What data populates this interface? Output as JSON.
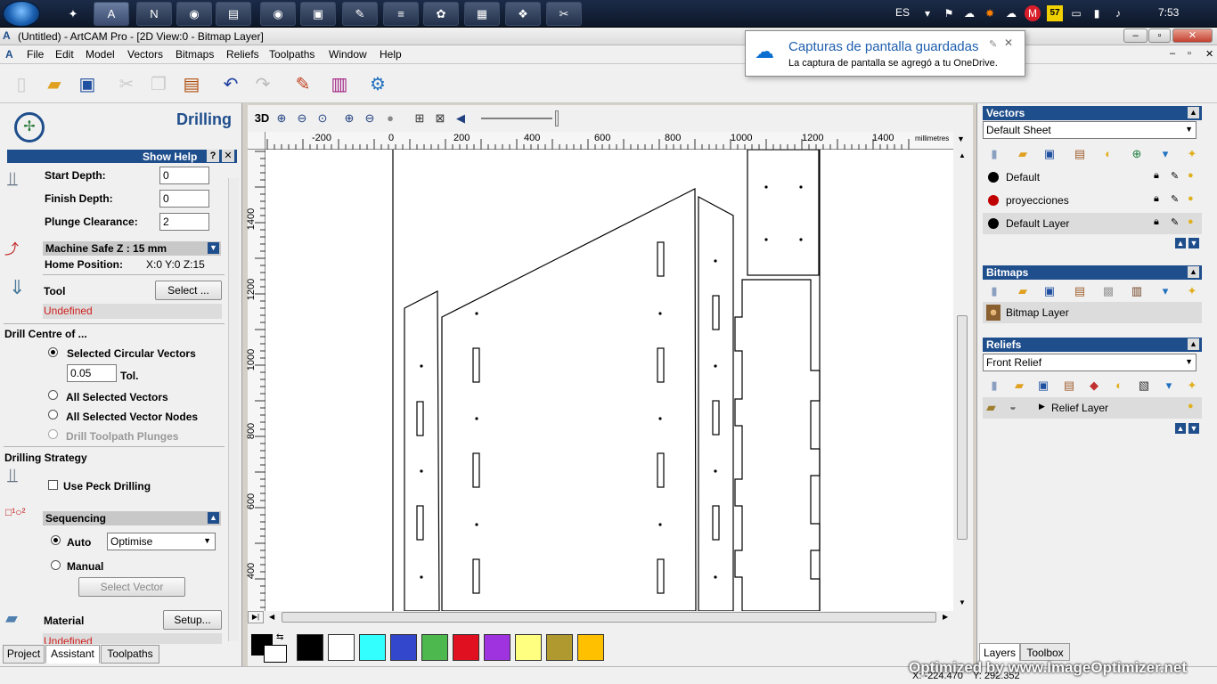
{
  "taskbar": {
    "lang": "ES",
    "clock": "7:53",
    "badge": "57"
  },
  "window": {
    "title": "(Untitled) - ArtCAM Pro - [2D View:0 - Bitmap Layer]"
  },
  "menu": [
    "File",
    "Edit",
    "Model",
    "Vectors",
    "Bitmaps",
    "Reliefs",
    "Toolpaths",
    "Window",
    "Help"
  ],
  "toast": {
    "title": "Capturas de pantalla guardadas",
    "body": "La captura de pantalla se agregó a tu OneDrive."
  },
  "left": {
    "title": "Drilling",
    "show_help": "Show Help",
    "start_depth_label": "Start Depth:",
    "start_depth": "0",
    "finish_depth_label": "Finish Depth:",
    "finish_depth": "0",
    "plunge_label": "Plunge Clearance:",
    "plunge": "2",
    "safe_z": "Machine Safe Z : 15 mm",
    "home_label": "Home Position:",
    "home_value": "X:0 Y:0 Z:15",
    "tool_label": "Tool",
    "select_btn": "Select ...",
    "tool_status": "Undefined",
    "drill_centre": "Drill Centre of ...",
    "opt_circular": "Selected Circular Vectors",
    "tol_value": "0.05",
    "tol_label": "Tol.",
    "opt_all_vectors": "All Selected Vectors",
    "opt_all_nodes": "All Selected Vector Nodes",
    "opt_plunges": "Drill Toolpath Plunges",
    "strategy": "Drilling Strategy",
    "peck": "Use Peck Drilling",
    "sequencing": "Sequencing",
    "auto": "Auto",
    "optimise": "Optimise",
    "manual": "Manual",
    "select_vector": "Select Vector",
    "material": "Material",
    "setup": "Setup...",
    "material_status": "Undefined",
    "tabs": [
      "Project",
      "Assistant",
      "Toolpaths"
    ]
  },
  "ruler": {
    "h_ticks": [
      "-200",
      "0",
      "200",
      "400",
      "600",
      "800",
      "1000",
      "1200",
      "1400"
    ],
    "unit": "millimetres",
    "v_ticks": [
      "1400",
      "1200",
      "1000",
      "800",
      "600",
      "400"
    ]
  },
  "colors": {
    "accent": "#1f4e8c",
    "swatches": [
      "#000000",
      "#ffffff",
      "#33ffff",
      "#3347cc",
      "#4db84d",
      "#e01020",
      "#a033e0",
      "#ffff80",
      "#b09a30",
      "#ffc000"
    ]
  },
  "vectors": {
    "header": "Vectors",
    "sheet": "Default Sheet",
    "layers": [
      {
        "name": "Default",
        "color": "#000000"
      },
      {
        "name": "proyecciones",
        "color": "#c00000"
      },
      {
        "name": "Default Layer",
        "color": "#000000"
      }
    ]
  },
  "bitmaps": {
    "header": "Bitmaps",
    "layer": "Bitmap Layer"
  },
  "reliefs": {
    "header": "Reliefs",
    "selected": "Front Relief",
    "layer": "Relief Layer"
  },
  "right_tabs": [
    "Layers",
    "Toolbox"
  ],
  "status": {
    "x": "X: -224.470",
    "y": "Y: 292.352"
  },
  "watermark": "Optimized by www.ImageOptimizer.net"
}
